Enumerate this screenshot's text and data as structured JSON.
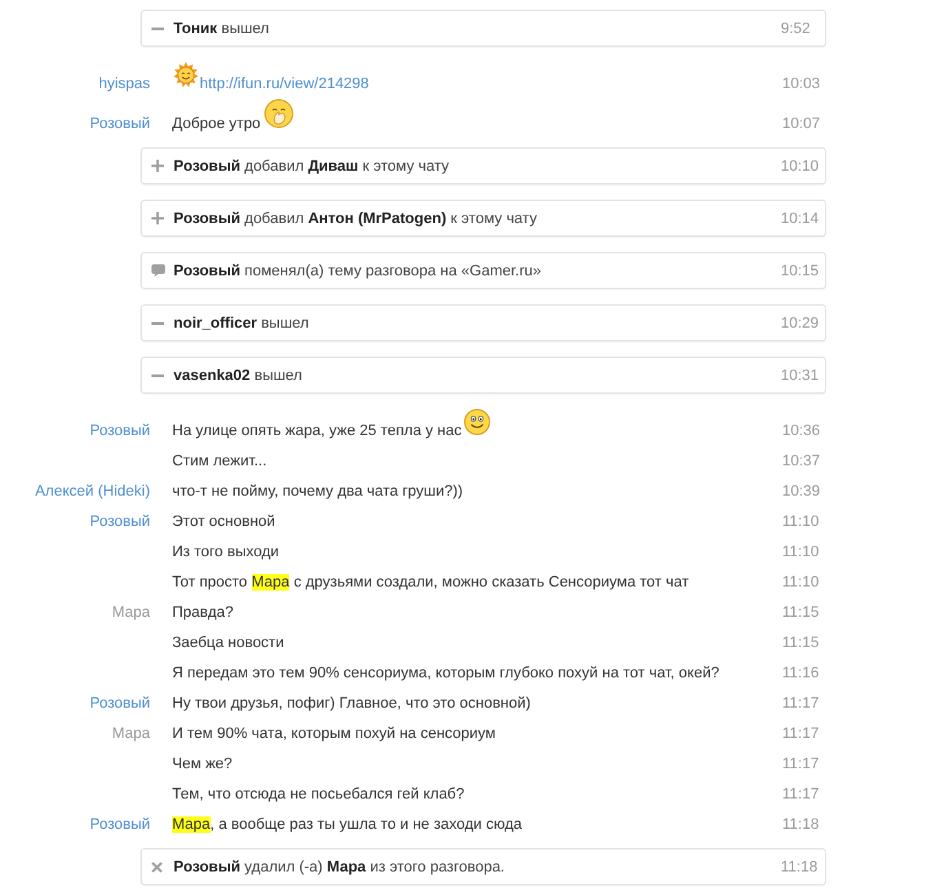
{
  "log": [
    {
      "kind": "left_event",
      "text": "**Тоник** вышел",
      "time": "9:52"
    },
    {
      "kind": "message",
      "sender": "hyispas",
      "color": "#4f8fd0",
      "time": "10:03",
      "content": [
        {
          "kind": "sun_emoji"
        },
        {
          "kind": "link",
          "text": "http://ifun.ru/view/214298"
        }
      ]
    },
    {
      "kind": "message",
      "sender": "Розовый",
      "color": "#4f8fd0",
      "time": "10:07",
      "content": [
        {
          "kind": "text",
          "text": "Доброе утро"
        },
        {
          "kind": "hand_emoji"
        }
      ]
    },
    {
      "kind": "added_event",
      "text": "**Розовый** добавил **Диваш** к этому чату",
      "time": "10:10"
    },
    {
      "kind": "added_event",
      "text": "**Розовый** добавил **Антон (MrPatogen)** к этому чату",
      "time": "10:14"
    },
    {
      "kind": "topic_event",
      "text": "**Розовый** поменял(а) тему разговора на «Gamer.ru»",
      "time": "10:15"
    },
    {
      "kind": "left_event",
      "text": "**noir_officer** вышел",
      "time": "10:29"
    },
    {
      "kind": "left_event",
      "text": "**vasenka02** вышел",
      "time": "10:31"
    },
    {
      "kind": "message",
      "sender": "Розовый",
      "color": "#4f8fd0",
      "time": "10:36",
      "content": [
        {
          "kind": "text",
          "text": "На улице опять жара, уже 25 тепла у нас"
        },
        {
          "kind": "smile_emoji"
        }
      ]
    },
    {
      "kind": "message",
      "time": "10:37",
      "content": [
        {
          "kind": "text",
          "text": "Стим лежит..."
        }
      ]
    },
    {
      "kind": "message",
      "sender": "Алексей (Hideki)",
      "color": "#4f8fd0",
      "time": "10:39",
      "content": [
        {
          "kind": "text",
          "text": "что-т не пойму, почему два чата груши?))"
        }
      ]
    },
    {
      "kind": "message",
      "sender": "Розовый",
      "color": "#4f8fd0",
      "time": "11:10",
      "content": [
        {
          "kind": "text",
          "text": "Этот основной"
        }
      ]
    },
    {
      "kind": "message",
      "time": "11:10",
      "content": [
        {
          "kind": "text",
          "text": "Из того выходи"
        }
      ]
    },
    {
      "kind": "message",
      "time": "11:10",
      "content": [
        {
          "kind": "text",
          "text": "Тот просто "
        },
        {
          "kind": "mention",
          "text": "Мара"
        },
        {
          "kind": "text",
          "text": " с друзьями создали, можно сказать Сенсориума тот чат"
        }
      ]
    },
    {
      "kind": "message",
      "sender": "Мара",
      "color": "#999999",
      "time": "11:15",
      "content": [
        {
          "kind": "text",
          "text": "Правда?"
        }
      ]
    },
    {
      "kind": "message",
      "time": "11:15",
      "content": [
        {
          "kind": "text",
          "text": "Заебца новости"
        }
      ]
    },
    {
      "kind": "message",
      "time": "11:16",
      "content": [
        {
          "kind": "text",
          "text": "Я передам это тем 90% сенсориума, которым глубоко похуй на тот чат, окей?"
        }
      ]
    },
    {
      "kind": "message",
      "sender": "Розовый",
      "color": "#4f8fd0",
      "time": "11:17",
      "content": [
        {
          "kind": "text",
          "text": "Ну твои друзья, пофиг) Главное, что это основной)"
        }
      ]
    },
    {
      "kind": "message",
      "sender": "Мара",
      "color": "#999999",
      "time": "11:17",
      "content": [
        {
          "kind": "text",
          "text": "И тем 90% чата, которым похуй на сенсориум"
        }
      ]
    },
    {
      "kind": "message",
      "time": "11:17",
      "content": [
        {
          "kind": "text",
          "text": "Чем же?"
        }
      ]
    },
    {
      "kind": "message",
      "time": "11:17",
      "content": [
        {
          "kind": "text",
          "text": "Тем, что отсюда не посьебался гей клаб?"
        }
      ]
    },
    {
      "kind": "message",
      "sender": "Розовый",
      "color": "#4f8fd0",
      "time": "11:18",
      "content": [
        {
          "kind": "mention",
          "text": "Мара"
        },
        {
          "kind": "text",
          "text": ", а вообще раз ты ушла то и не заходи сюда"
        }
      ]
    },
    {
      "kind": "removed_event",
      "text": "**Розовый** удалил (-а) **Мара** из этого разговора.",
      "time": "11:18"
    }
  ]
}
